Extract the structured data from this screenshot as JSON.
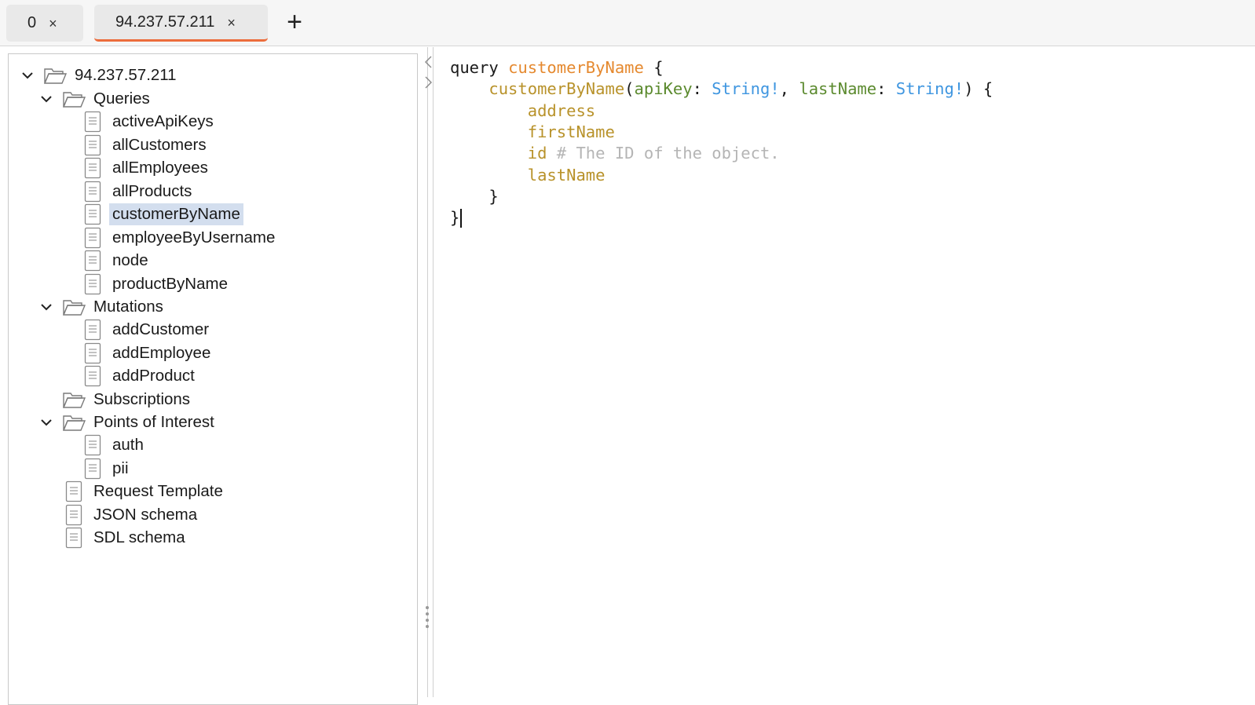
{
  "tabs": [
    {
      "label": "0",
      "close": "×",
      "active": false
    },
    {
      "label": "94.237.57.211",
      "close": "×",
      "active": true
    }
  ],
  "new_tab_label": "+",
  "tree": {
    "root": "94.237.57.211",
    "queries": {
      "label": "Queries",
      "items": [
        "activeApiKeys",
        "allCustomers",
        "allEmployees",
        "allProducts",
        "customerByName",
        "employeeByUsername",
        "node",
        "productByName"
      ]
    },
    "mutations": {
      "label": "Mutations",
      "items": [
        "addCustomer",
        "addEmployee",
        "addProduct"
      ]
    },
    "subscriptions": {
      "label": "Subscriptions"
    },
    "points_of_interest": {
      "label": "Points of Interest",
      "items": [
        "auth",
        "pii"
      ]
    },
    "files": [
      "Request Template",
      "JSON schema",
      "SDL schema"
    ],
    "selected": "customerByName"
  },
  "editor": {
    "keyword": "query",
    "operation_name": "customerByName",
    "open_brace": "{",
    "field_name": "customerByName",
    "paren_open": "(",
    "arg1_name": "apiKey",
    "colon": ":",
    "arg1_type": "String!",
    "comma": ",",
    "arg2_name": "lastName",
    "arg2_type": "String!",
    "paren_close": ")",
    "fields": [
      "address",
      "firstName",
      "id",
      "lastName"
    ],
    "id_comment": "# The ID of the object.",
    "close_brace": "}"
  },
  "colors": {
    "tab_active_accent": "#ec6d3c",
    "selection": "#d3deee",
    "op_name": "#e5892f",
    "field": "#b8922a",
    "arg_name": "#5b8a2e",
    "arg_type": "#3f96e0",
    "comment": "#b5b5b5"
  }
}
